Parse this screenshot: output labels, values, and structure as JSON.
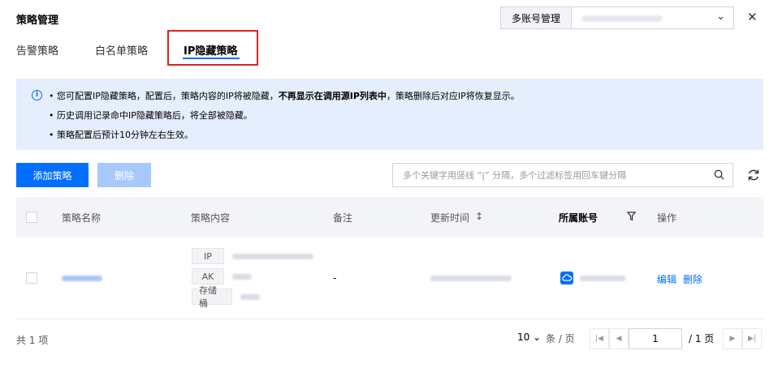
{
  "header": {
    "title": "策略管理",
    "account_label": "多账号管理",
    "close_icon": "close-icon",
    "dropdown_icon": "chevron-down-icon"
  },
  "tabs": [
    {
      "label": "告警策略",
      "active": false
    },
    {
      "label": "白名单策略",
      "active": false
    },
    {
      "label": "IP隐藏策略",
      "active": true
    }
  ],
  "notice": {
    "line1_pre": "• 您可配置IP隐藏策略，配置后，策略内容的IP将被隐藏，",
    "line1_bold": "不再显示在调用源IP列表中",
    "line1_post": "，策略删除后对应IP将恢复显示。",
    "line2": "• 历史调用记录命中IP隐藏策略后，将全部被隐藏。",
    "line3": "• 策略配置后预计10分钟左右生效。"
  },
  "toolbar": {
    "add_label": "添加策略",
    "delete_label": "删除",
    "search_placeholder": "多个关键字用竖线 “|” 分隔，多个过滤标签用回车键分隔"
  },
  "table": {
    "columns": [
      "策略名称",
      "策略内容",
      "备注",
      "更新时间",
      "所属账号",
      "操作"
    ],
    "sort_icon": "↕",
    "filter_icon": "filter-icon",
    "rows": [
      {
        "tags": [
          "IP",
          "AK",
          "存储桶"
        ],
        "remark": "-",
        "actions": [
          "编辑",
          "删除"
        ]
      }
    ]
  },
  "footer": {
    "total": "共 1 项",
    "page_size": "10",
    "page_size_unit": "条 / 页",
    "current_page": "1",
    "total_pages": "/ 1 页"
  },
  "colors": {
    "primary": "#006eff",
    "notice_bg": "#e5eefc",
    "highlight": "#e02020"
  }
}
